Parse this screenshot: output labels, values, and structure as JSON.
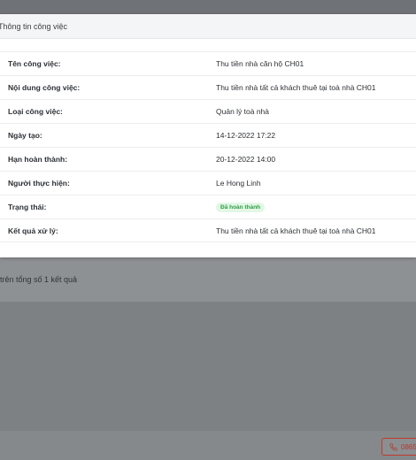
{
  "modal": {
    "title": "Thông tin công việc",
    "rows": [
      {
        "label": "Tên công việc:",
        "value": "Thu tiền nhà căn hộ CH01"
      },
      {
        "label": "Nội dung công việc:",
        "value": "Thu tiền nhà tất cả khách thuê tại toà nhà CH01"
      },
      {
        "label": "Loại công việc:",
        "value": "Quản lý toà nhà"
      },
      {
        "label": "Ngày tạo:",
        "value": "14-12-2022 17:22"
      },
      {
        "label": "Hạn hoàn thành:",
        "value": "20-12-2022 14:00"
      },
      {
        "label": "Người thực hiện:",
        "value": "Le Hong Linh"
      },
      {
        "label": "Trạng thái:",
        "value": "Đã hoàn thành",
        "status_color": "#2f9e44"
      },
      {
        "label": "Kết quả xử lý:",
        "value": "Thu tiền nhà tất cả khách thuê tại toà nhà CH01"
      }
    ]
  },
  "background": {
    "pagination_text": "trên tổng số 1 kết quả",
    "phone_button": {
      "icon": "phone-icon",
      "label": "0865"
    }
  }
}
